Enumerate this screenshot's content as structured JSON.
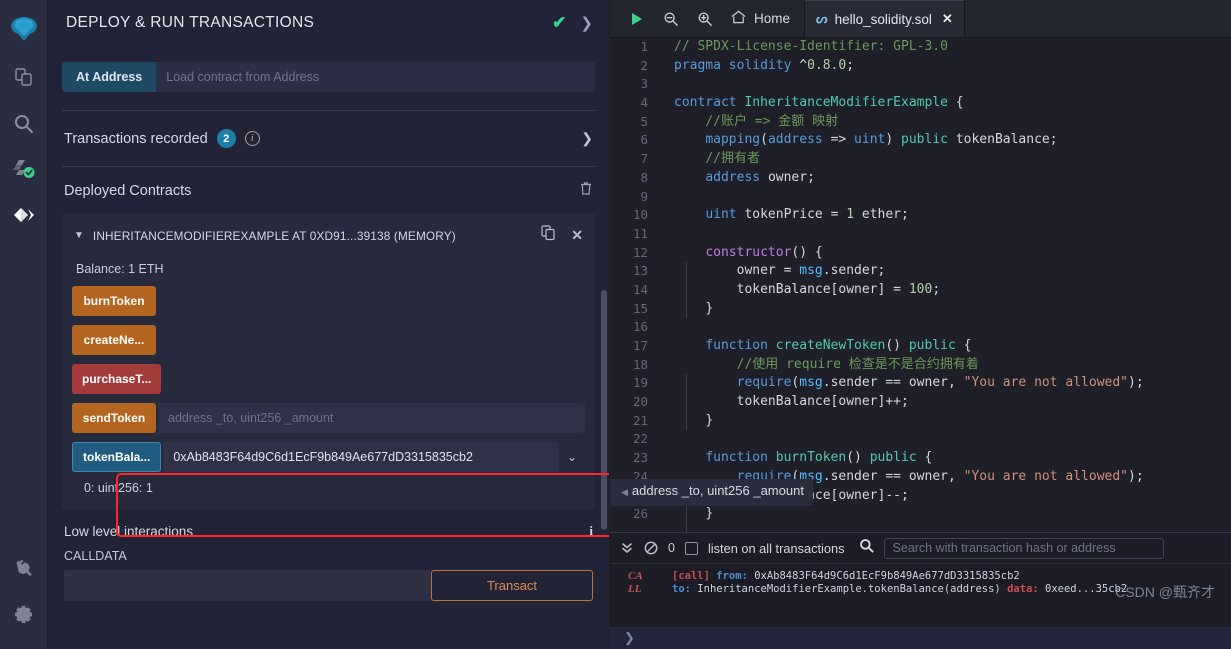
{
  "iconbar": {
    "items": [
      {
        "name": "remix-logo-icon",
        "label": "Remix"
      },
      {
        "name": "file-explorer-icon",
        "label": "File explorers"
      },
      {
        "name": "search-icon",
        "label": "Search in files"
      },
      {
        "name": "solidity-compiler-icon",
        "label": "Solidity compiler"
      },
      {
        "name": "deploy-run-icon",
        "label": "Deploy & run transactions"
      },
      {
        "name": "plugin-manager-icon",
        "label": "Plugin manager"
      },
      {
        "name": "settings-icon",
        "label": "Settings"
      }
    ]
  },
  "panel": {
    "title": "DEPLOY & RUN TRANSACTIONS",
    "at_address": {
      "button_label": "At Address",
      "placeholder": "Load contract from Address",
      "value": ""
    },
    "transactions_recorded": {
      "label": "Transactions recorded",
      "count": "2"
    },
    "deployed_contracts": {
      "title": "Deployed Contracts",
      "contract": {
        "title": "INHERITANCEMODIFIEREXAMPLE AT 0XD91...39138 (MEMORY)",
        "balance": "Balance: 1 ETH",
        "functions": [
          {
            "label": "burnToken",
            "color": "orange",
            "input_placeholder": "",
            "input_value": "",
            "has_input": false
          },
          {
            "label": "createNe...",
            "color": "orange",
            "input_placeholder": "",
            "input_value": "",
            "has_input": false
          },
          {
            "label": "purchaseT...",
            "color": "red",
            "input_placeholder": "",
            "input_value": "",
            "has_input": false
          },
          {
            "label": "sendToken",
            "color": "orange",
            "input_placeholder": "address _to, uint256 _amount",
            "input_value": "",
            "has_input": true
          },
          {
            "label": "tokenBala...",
            "color": "blue",
            "input_placeholder": "",
            "input_value": "0xAb8483F64d9C6d1EcF9b849Ae677dD3315835cb2",
            "has_input": true
          }
        ],
        "result": "0: uint256: 1"
      }
    },
    "low_level": {
      "title": "Low level interactions",
      "calldata_label": "CALLDATA",
      "calldata_value": "",
      "transact_label": "Transact"
    }
  },
  "tabbar": {
    "run_label": "Run",
    "zoom_out_label": "Zoom out",
    "zoom_in_label": "Zoom in",
    "home_label": "Home",
    "tab_label": "hello_solidity.sol"
  },
  "editor": {
    "tooltip": "address _to, uint256 _amount",
    "lines": [
      {
        "n": "1",
        "html": "<span class='c-com'>// SPDX-License-Identifier: GPL-3.0</span>"
      },
      {
        "n": "2",
        "html": "<span class='c-kw2'>pragma</span> <span class='c-kw2'>solidity</span> <span class='c-op'>^</span><span class='c-num'>0.8.0</span><span class='c-op'>;</span>"
      },
      {
        "n": "3",
        "html": ""
      },
      {
        "n": "4",
        "html": "<span class='c-kw2'>contract</span> <span class='c-type'>InheritanceModifierExample</span> <span class='c-op'>{</span>"
      },
      {
        "n": "5",
        "html": "    <span class='c-com'>//账户 =&gt; 金额 映射</span>"
      },
      {
        "n": "6",
        "html": "    <span class='c-kw2'>mapping</span><span class='c-op'>(</span><span class='c-kw2'>address</span> <span class='c-op'>=&gt;</span> <span class='c-kw2'>uint</span><span class='c-op'>)</span> <span class='c-type'>public</span> <span class='c-id'>tokenBalance</span><span class='c-op'>;</span>"
      },
      {
        "n": "7",
        "html": "    <span class='c-com'>//拥有者</span>"
      },
      {
        "n": "8",
        "html": "    <span class='c-kw2'>address</span> <span class='c-id'>owner</span><span class='c-op'>;</span>"
      },
      {
        "n": "9",
        "html": ""
      },
      {
        "n": "10",
        "html": "    <span class='c-kw2'>uint</span> <span class='c-id'>tokenPrice</span> <span class='c-op'>=</span> <span class='c-num'>1</span> <span class='c-id'>ether</span><span class='c-op'>;</span>"
      },
      {
        "n": "11",
        "html": ""
      },
      {
        "n": "12",
        "html": "    <span class='c-kw'>constructor</span><span class='c-op'>() {</span>"
      },
      {
        "n": "13",
        "html": "        <span class='c-id'>owner</span> <span class='c-op'>=</span> <span class='c-glob'>msg</span><span class='c-op'>.</span><span class='c-id'>sender</span><span class='c-op'>;</span>"
      },
      {
        "n": "14",
        "html": "        <span class='c-id'>tokenBalance</span><span class='c-op'>[</span><span class='c-id'>owner</span><span class='c-op'>] =</span> <span class='c-num'>100</span><span class='c-op'>;</span>"
      },
      {
        "n": "15",
        "html": "    <span class='c-op'>}</span>"
      },
      {
        "n": "16",
        "html": ""
      },
      {
        "n": "17",
        "html": "    <span class='c-kw2'>function</span> <span class='c-fn'>createNewToken</span><span class='c-op'>()</span> <span class='c-type'>public</span> <span class='c-op'>{</span>"
      },
      {
        "n": "18",
        "html": "        <span class='c-com'>//使用 require 检查是不是合约拥有着</span>"
      },
      {
        "n": "19",
        "html": "        <span class='c-kw2'>require</span><span class='c-op'>(</span><span class='c-glob'>msg</span><span class='c-op'>.</span><span class='c-id'>sender</span> <span class='c-op'>==</span> <span class='c-id'>owner</span><span class='c-op'>,</span> <span class='c-str'>\"You are not allowed\"</span><span class='c-op'>);</span>"
      },
      {
        "n": "20",
        "html": "        <span class='c-id'>tokenBalance</span><span class='c-op'>[</span><span class='c-id'>owner</span><span class='c-op'>]++;</span>"
      },
      {
        "n": "21",
        "html": "    <span class='c-op'>}</span>"
      },
      {
        "n": "22",
        "html": ""
      },
      {
        "n": "23",
        "html": "    <span class='c-kw2'>function</span> <span class='c-fn'>burnToken</span><span class='c-op'>()</span> <span class='c-type'>public</span> <span class='c-op'>{</span>"
      },
      {
        "n": "24",
        "html": "        <span class='c-kw2'>require</span><span class='c-op'>(</span><span class='c-glob'>msg</span><span class='c-op'>.</span><span class='c-id'>sender</span> <span class='c-op'>==</span> <span class='c-id'>owner</span><span class='c-op'>,</span> <span class='c-str'>\"You are not allowed\"</span><span class='c-op'>);</span>"
      },
      {
        "n": "25",
        "html": "        <span class='c-id'>tokenBalance</span><span class='c-op'>[</span><span class='c-id'>owner</span><span class='c-op'>]--;</span>"
      },
      {
        "n": "26",
        "html": "    <span class='c-op'>}</span>"
      }
    ]
  },
  "terminal": {
    "error_count": "0",
    "listen_label": "listen on all transactions",
    "listen_checked": false,
    "search_placeholder": "Search with transaction hash or address",
    "search_value": "",
    "log": {
      "tag_line1": "CA",
      "tag_line2": "LL",
      "line1_prefix": "[call]",
      "line1_from_label": "from:",
      "line1_from": "0xAb8483F64d9C6d1EcF9b849Ae677dD3315835cb2",
      "line2_to_label": "to:",
      "line2_to": "InheritanceModifierExample.tokenBalance(address)",
      "line2_data_label": "data:",
      "line2_data": "0xeed...35cb2"
    },
    "prompt": "❯"
  },
  "watermark": "CSDN @甄齐才",
  "colors": {
    "accent_blue": "#1d7fa8",
    "orange_btn": "#b4651f",
    "red_btn": "#a33b3b",
    "blue_btn": "#1f5c80",
    "highlight_red": "#ff2727",
    "success_green": "#36d399"
  }
}
